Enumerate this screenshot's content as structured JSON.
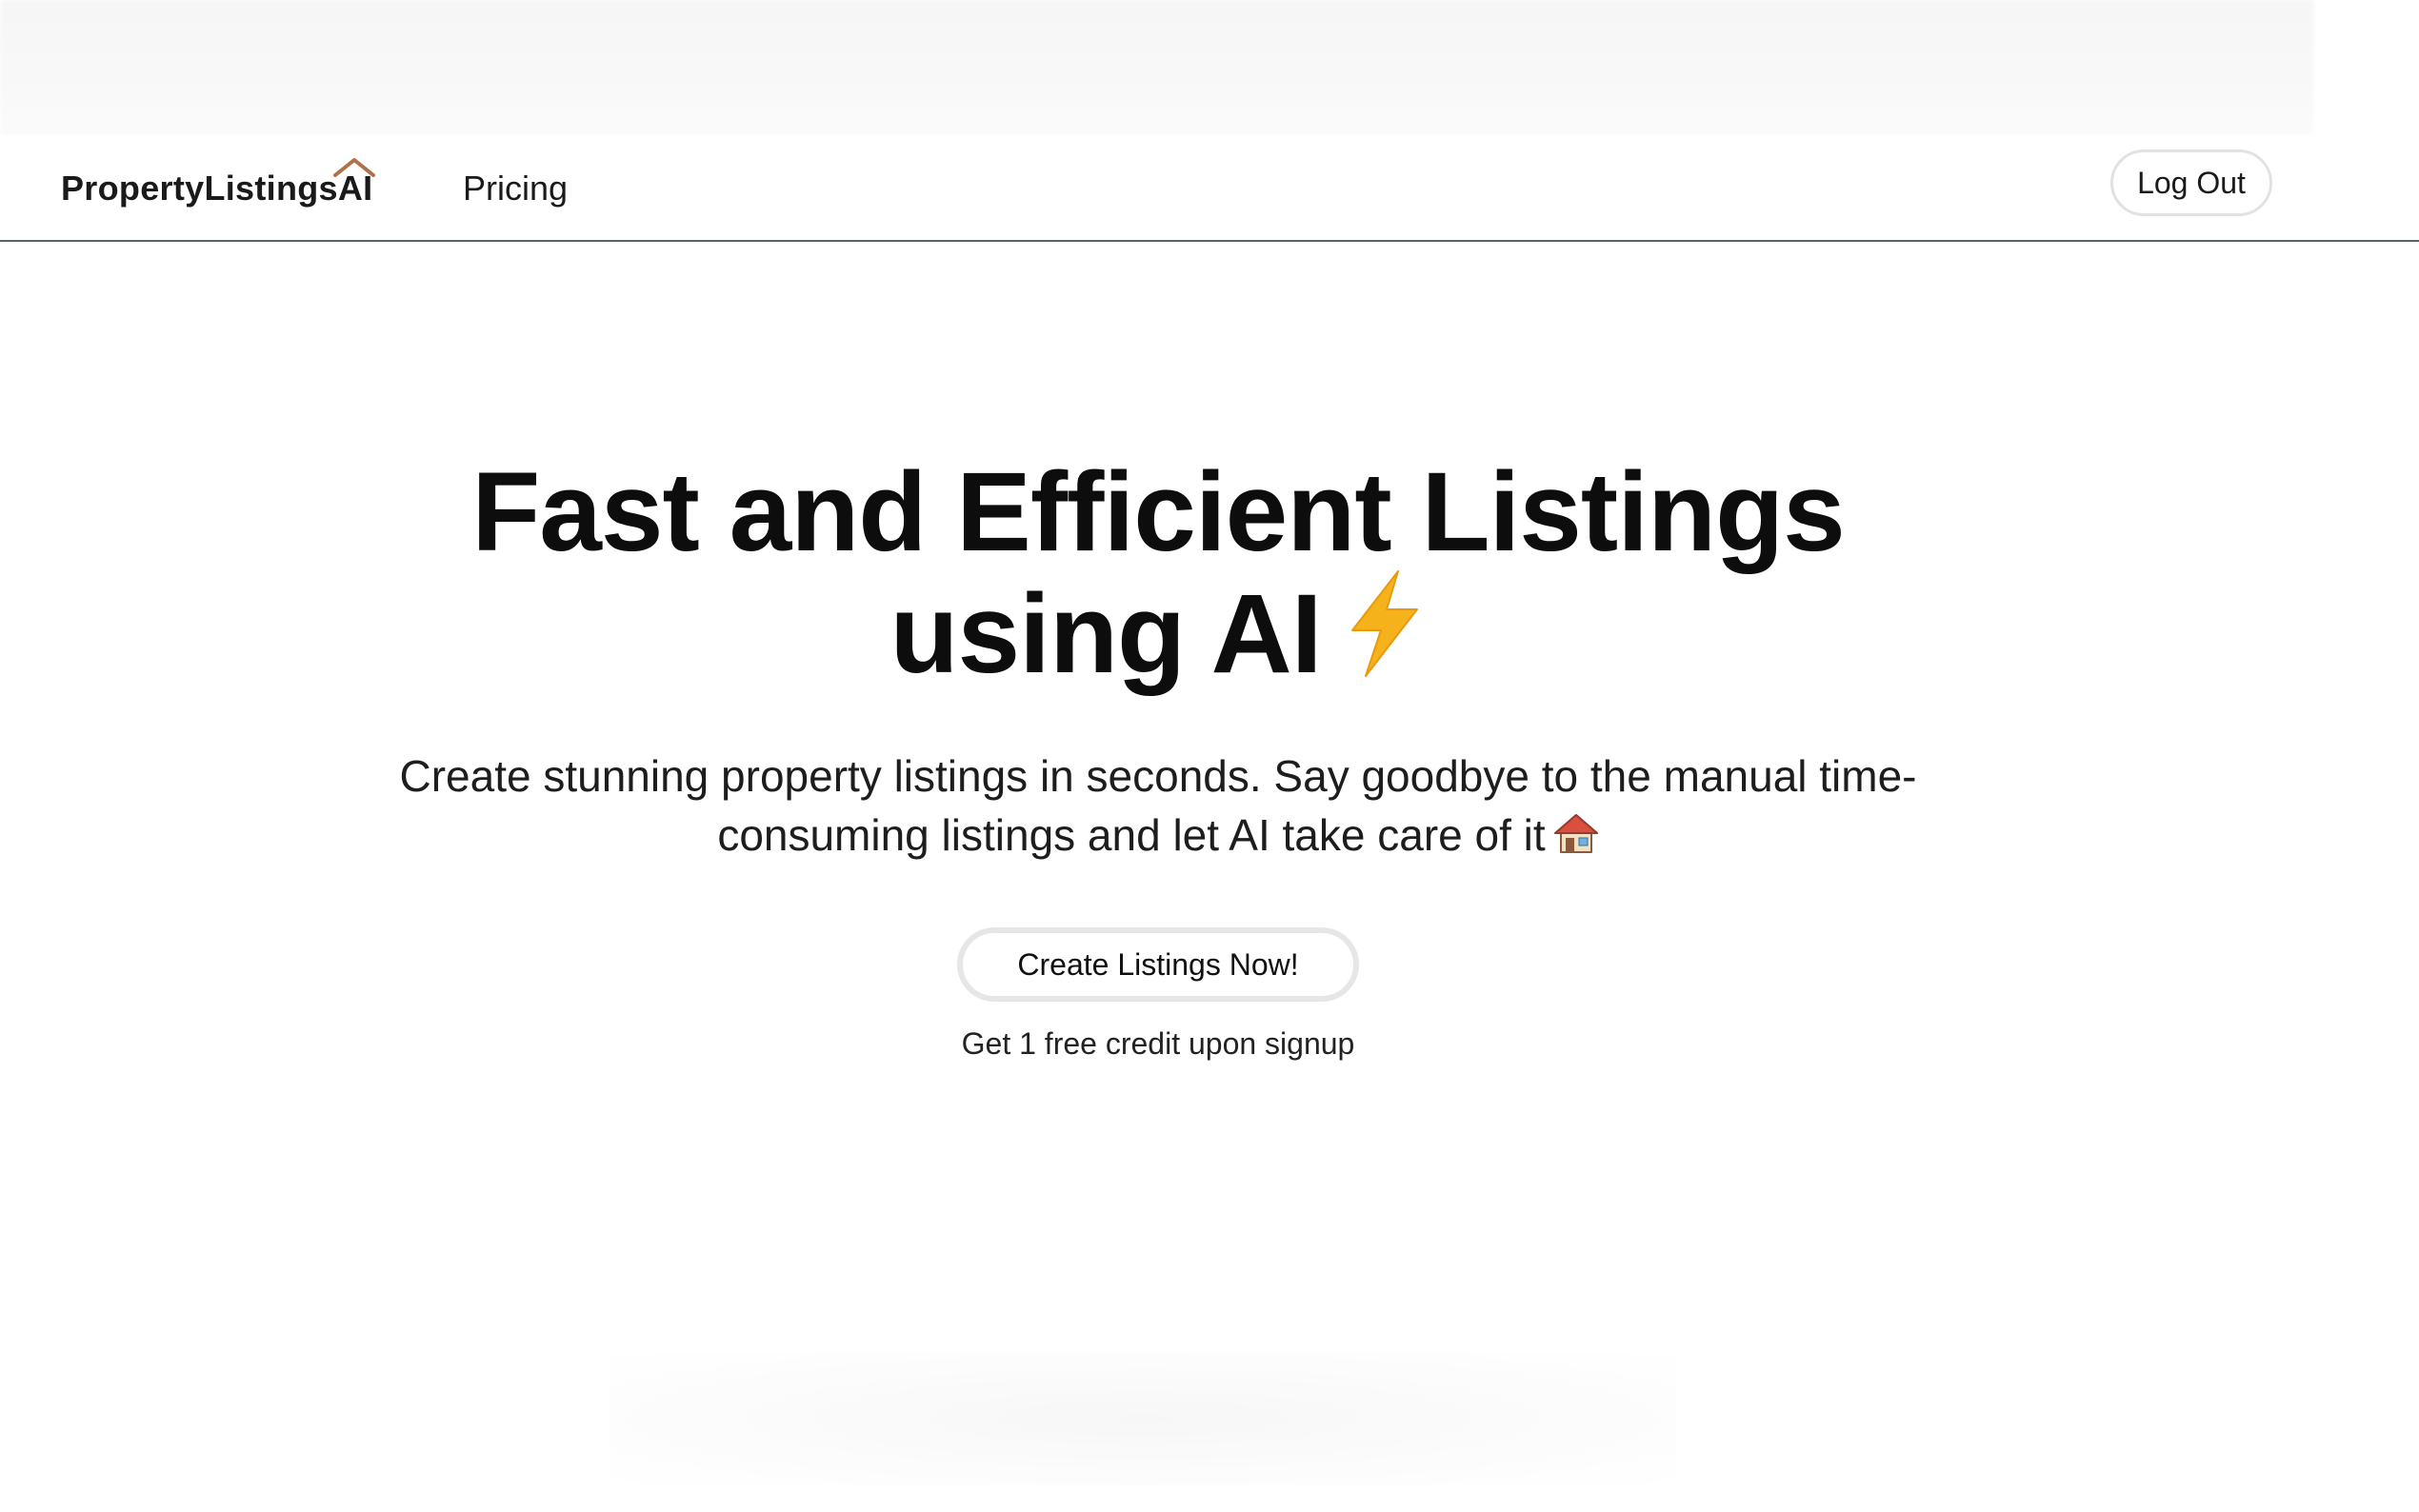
{
  "nav": {
    "logo": "PropertyListingsAI",
    "pricing": "Pricing",
    "logout": "Log Out"
  },
  "hero": {
    "headline_line1": "Fast and Efficient Listings",
    "headline_line2": "using AI",
    "subtext_line1": "Create stunning property listings in seconds. Say goodbye to the manual time-",
    "subtext_line2": "consuming listings and let AI take care of it",
    "cta": "Create Listings Now!",
    "note": "Get 1 free credit upon signup"
  },
  "icons": {
    "logo_roof": "house-roof-icon",
    "bolt": "lightning-bolt-icon",
    "house": "house-icon"
  },
  "colors": {
    "roof": "#b0704a",
    "bolt": "#f5b21a",
    "divider": "#5a6170"
  }
}
